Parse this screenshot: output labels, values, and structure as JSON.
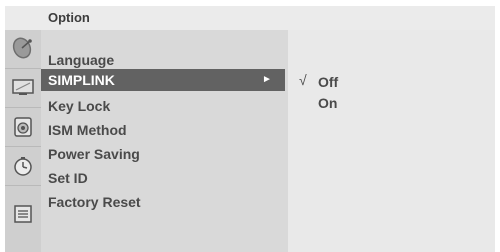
{
  "title": "Option",
  "icons": [
    "satellite-dish-icon",
    "picture-icon",
    "audio-icon",
    "time-icon",
    "option-icon"
  ],
  "menu": {
    "items": [
      {
        "label": "Language",
        "selected": false
      },
      {
        "label": "SIMPLINK",
        "selected": true,
        "arrow": "►"
      },
      {
        "label": "Key Lock",
        "selected": false
      },
      {
        "label": "ISM Method",
        "selected": false
      },
      {
        "label": "Power Saving",
        "selected": false
      },
      {
        "label": "Set ID",
        "selected": false
      },
      {
        "label": "Factory Reset",
        "selected": false
      }
    ]
  },
  "submenu": {
    "check_mark": "√",
    "options": [
      {
        "label": "Off",
        "checked": true
      },
      {
        "label": "On",
        "checked": false
      }
    ]
  },
  "colors": {
    "selected_bg": "#626262",
    "menu_bg": "#d9d9d9",
    "submenu_bg": "#e9e9e9",
    "icon_column_bg": "#cfcfcf"
  }
}
